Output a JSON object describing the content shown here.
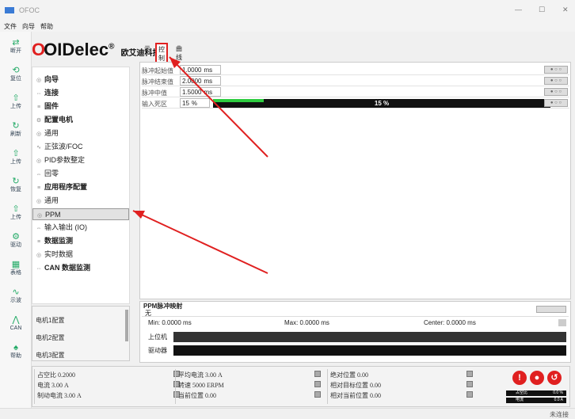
{
  "window": {
    "title": "OFOC",
    "menu": [
      "文件",
      "向导",
      "帮助"
    ],
    "controls": [
      "—",
      "☐",
      "✕"
    ]
  },
  "toolbar": [
    {
      "icon": "connect-icon",
      "label": "断开"
    },
    {
      "icon": "reset-icon",
      "label": "复位"
    },
    {
      "icon": "arrow-up-icon",
      "label": "上传"
    },
    {
      "icon": "refresh-icon",
      "label": "刷新"
    },
    {
      "icon": "arrow-up-icon",
      "label": "上传"
    },
    {
      "icon": "refresh-icon",
      "label": "恢复"
    },
    {
      "icon": "arrow-up-icon",
      "label": "上传"
    },
    {
      "icon": "drive-icon",
      "label": "驱动"
    },
    {
      "icon": "table-icon",
      "label": "表格"
    },
    {
      "icon": "scope-icon",
      "label": "示波"
    },
    {
      "icon": "can-icon",
      "label": "CAN"
    },
    {
      "icon": "help-icon",
      "label": "帮助"
    }
  ],
  "logo": {
    "brand": "OIDelec",
    "reg": "®",
    "company": "欧艾迪科技"
  },
  "tabs": [
    "示",
    "控制",
    "曲线"
  ],
  "tree": [
    {
      "icon": "◎",
      "label": "向导",
      "bold": true
    },
    {
      "icon": "⇔",
      "label": "连接",
      "bold": true
    },
    {
      "icon": "≡",
      "label": "固件",
      "bold": true
    },
    {
      "icon": "⚙",
      "label": "配置电机",
      "bold": true
    },
    {
      "icon": "◎",
      "label": "通用",
      "bold": false
    },
    {
      "icon": "∿",
      "label": "正弦波/FOC",
      "bold": false
    },
    {
      "icon": "◎",
      "label": "PID参数整定",
      "bold": false
    },
    {
      "icon": "⇔",
      "label": "回零",
      "bold": false
    },
    {
      "icon": "≡",
      "label": "应用程序配置",
      "bold": true
    },
    {
      "icon": "◎",
      "label": "通用",
      "bold": false
    },
    {
      "icon": "◎",
      "label": "PPM",
      "bold": false
    },
    {
      "icon": "⇔",
      "label": "输入输出 (IO)",
      "bold": false
    },
    {
      "icon": "≡",
      "label": "数据监测",
      "bold": true
    },
    {
      "icon": "◎",
      "label": "实时数据",
      "bold": false
    },
    {
      "icon": "⇔",
      "label": "CAN 数据监测",
      "bold": true
    }
  ],
  "motors": [
    "电机1配置",
    "电机2配置",
    "电机3配置"
  ],
  "ppm_params": [
    {
      "label": "脉冲起始值",
      "value": "1.0000",
      "unit": "ms"
    },
    {
      "label": "脉冲结束值",
      "value": "2.0000",
      "unit": "ms"
    },
    {
      "label": "脉冲中值",
      "value": "1.5000",
      "unit": "ms"
    },
    {
      "label": "输入死区",
      "value": "15",
      "unit": "%"
    }
  ],
  "deadzone": {
    "percent": 15,
    "text": "15 %"
  },
  "monitor": {
    "title": "PPM脉冲映射",
    "value": "无",
    "min": "Min: 0.0000 ms",
    "max": "Max: 0.0000 ms",
    "center": "Center: 0.0000 ms",
    "rows": [
      "上位机",
      "驱动器"
    ]
  },
  "status": [
    [
      "占空比 0.2000",
      "电流 3.00 A",
      "制动电流 3.00 A"
    ],
    [
      "平均电流 3.00 A",
      "转速 5000 ERPM",
      "当前位置 0.00"
    ],
    [
      "绝对位置 0.00",
      "相对目标位置 0.00",
      "相对当前位置 0.00"
    ]
  ],
  "gauge": [
    {
      "l": "占空比",
      "r": "0.0 %"
    },
    {
      "l": "电流",
      "r": "0.0 A"
    }
  ],
  "statusbar": "未连接"
}
